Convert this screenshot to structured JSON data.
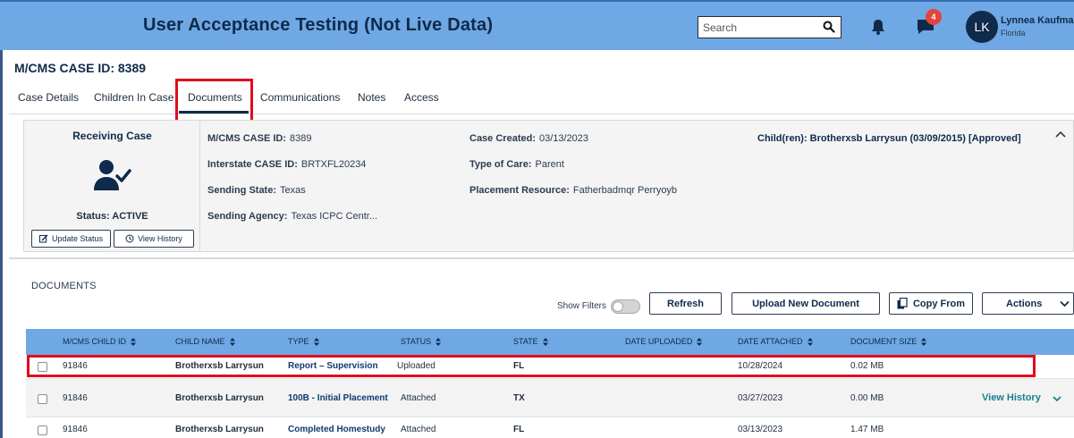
{
  "header": {
    "title": "User Acceptance Testing (Not Live Data)",
    "search_placeholder": "Search",
    "notification_count": "4",
    "user": {
      "initials": "LK",
      "name": "Lynnea Kaufman",
      "state": "Florida"
    }
  },
  "case_heading": "M/CMS CASE ID: 8389",
  "tabs": [
    {
      "label": "Case Details"
    },
    {
      "label": "Children In Case"
    },
    {
      "label": "Documents",
      "active": true
    },
    {
      "label": "Communications"
    },
    {
      "label": "Notes"
    },
    {
      "label": "Access"
    }
  ],
  "summary": {
    "receiving_title": "Receiving Case",
    "status": "Status: ACTIVE",
    "update_status_label": "Update Status",
    "view_history_label": "View History",
    "fields": {
      "mcms_case_id": {
        "label": "M/CMS CASE ID:",
        "value": "8389"
      },
      "interstate_case_id": {
        "label": "Interstate CASE ID:",
        "value": "BRTXFL20234"
      },
      "sending_state": {
        "label": "Sending State:",
        "value": "Texas"
      },
      "sending_agency": {
        "label": "Sending Agency:",
        "value": "Texas ICPC Centr..."
      },
      "case_created": {
        "label": "Case Created:",
        "value": "03/13/2023"
      },
      "type_of_care": {
        "label": "Type of Care:",
        "value": "Parent"
      },
      "placement_resource": {
        "label": "Placement Resource:",
        "value": "Fatherbadmqr Perryoyb"
      }
    },
    "children_line": "Child(ren): Brotherxsb Larrysun (03/09/2015)  [Approved]"
  },
  "documents": {
    "section_title": "DOCUMENTS",
    "show_filters_label": "Show Filters",
    "buttons": {
      "refresh": "Refresh",
      "upload": "Upload New Document",
      "copy_from": "Copy From",
      "actions": "Actions"
    },
    "columns": [
      "M/CMS CHILD ID",
      "CHILD NAME",
      "TYPE",
      "STATUS",
      "STATE",
      "DATE UPLOADED",
      "DATE ATTACHED",
      "DOCUMENT SIZE"
    ],
    "rows": [
      {
        "child_id": "91846",
        "child_name": "Brotherxsb Larrysun",
        "type": "Report – Supervision",
        "status": "Uploaded",
        "state": "FL",
        "date_uploaded": "",
        "date_attached": "10/28/2024",
        "size": "0.02 MB"
      },
      {
        "child_id": "91846",
        "child_name": "Brotherxsb Larrysun",
        "type": "100B - Initial Placement",
        "status": "Attached",
        "state": "TX",
        "date_uploaded": "",
        "date_attached": "03/27/2023",
        "size": "0.00 MB",
        "view_history": "View History"
      },
      {
        "child_id": "91846",
        "child_name": "Brotherxsb Larrysun",
        "type": "Completed Homestudy",
        "status": "Attached",
        "state": "FL",
        "date_uploaded": "",
        "date_attached": "03/13/2023",
        "size": "1.47 MB"
      }
    ]
  },
  "colors": {
    "header_bg": "#6fa8e4",
    "navy": "#0f2a4a",
    "highlight": "#e00d1c",
    "badge": "#e0453b",
    "link": "#1a7f8e"
  }
}
